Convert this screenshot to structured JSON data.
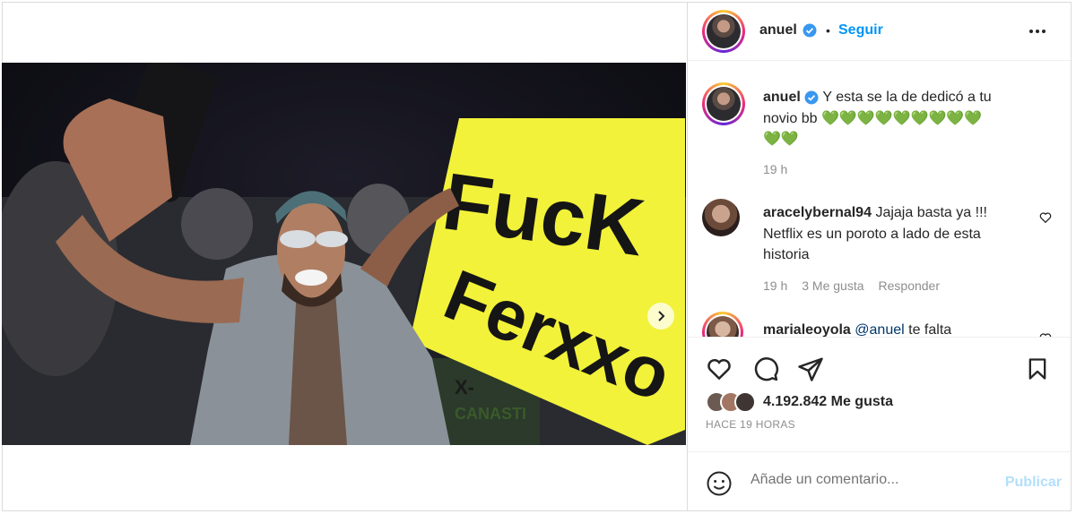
{
  "post": {
    "username": "anuel",
    "follow_label": "Seguir",
    "separator": "•",
    "sign_text_line1": "FucK",
    "sign_text_line2": "Ferxxo",
    "sign_text_small": "X-",
    "sign_text_small2": "CANASTI",
    "image_page": 1,
    "image_count": 2
  },
  "caption": {
    "username": "anuel",
    "text_line1": "Y esta se la de dedicó a tu",
    "text_line2": "novio bb 💚💚💚💚💚💚💚💚💚",
    "text_line3": "💚💚",
    "time": "19 h"
  },
  "comments": [
    {
      "username": "aracelybernal94",
      "text_line1": "Jajaja basta ya !!!",
      "text_line2": "Netflix es un poroto a lado de esta",
      "text_line3": "historia",
      "time": "19 h",
      "likes": "3 Me gusta",
      "reply_label": "Responder"
    },
    {
      "username": "marialeoyola",
      "mention": "@anuel",
      "text": "te falta"
    }
  ],
  "actions": {
    "likes": "4.192.842 Me gusta",
    "time_ago": "HACE 19 HORAS"
  },
  "add_comment": {
    "placeholder": "Añade un comentario...",
    "publish_label": "Publicar"
  },
  "colors": {
    "link_blue": "#0095f6",
    "publish_disabled": "#b2dffc",
    "verified_blue": "#3897f0",
    "heart_green": "#2ecc40",
    "sign_yellow": "#f2f23a"
  }
}
